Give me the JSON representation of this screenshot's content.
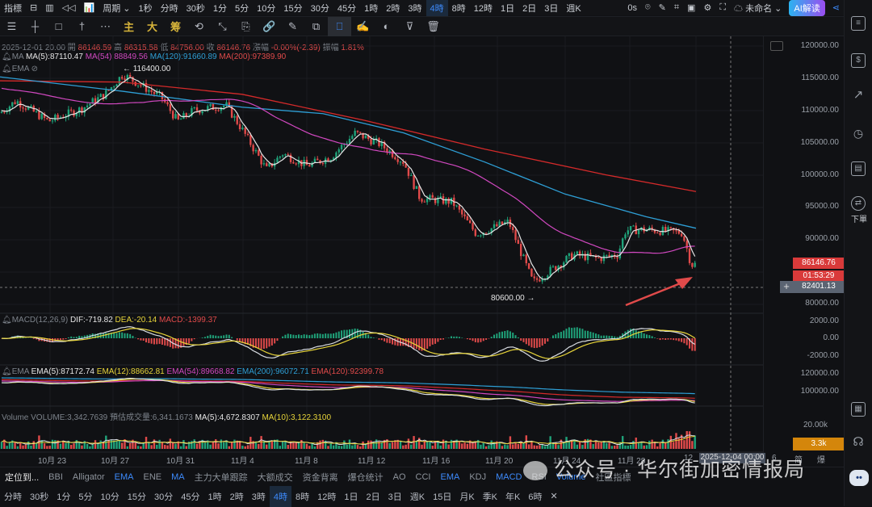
{
  "topbar": {
    "items": [
      "指標",
      "⊟",
      "▥",
      "◁◁",
      "📊",
      "周期 ⌄",
      "1秒",
      "分時",
      "30秒",
      "1分",
      "5分",
      "10分",
      "15分",
      "30分",
      "45分",
      "1時",
      "2時",
      "3時",
      "4時",
      "8時",
      "12時",
      "1日",
      "2日",
      "3日",
      "週K"
    ],
    "active": "4時",
    "timer": "0s",
    "workspace": "未命名",
    "ai_label": "AI解读"
  },
  "toolbar2": {
    "tools": [
      "☰",
      "┼",
      "□",
      "†",
      "⋯"
    ],
    "yellow": [
      "主",
      "大",
      "筹"
    ],
    "more": [
      "⟲",
      "⤡",
      "⎘",
      "🔗",
      "✎",
      "⧉",
      "⎕",
      "✍",
      "◐",
      "⊽",
      "🗑"
    ]
  },
  "info": {
    "date": "2025-12-01 20:00",
    "open_label": "開",
    "open": "86146.59",
    "high_label": "高",
    "high": "86315.58",
    "low_label": "低",
    "low": "84756.00",
    "close_label": "收",
    "close": "86146.76",
    "chg_label": "漲幅",
    "chg": "-0.00%(-2.39)",
    "amp_label": "振幅",
    "amp": "1.81%"
  },
  "ma": {
    "label": "MA",
    "ma5": "MA(5):87110.47",
    "ma54": "MA(54):88849.56",
    "ma120": "MA(120):91660.89",
    "ma200": "MA(200):97389.90"
  },
  "ema_toggle": "EMA",
  "annotations": {
    "high": "← 116400.00",
    "low": "80600.00 →"
  },
  "price_axis": [
    "120000.00",
    "115000.00",
    "110000.00",
    "105000.00",
    "100000.00",
    "95000.00",
    "90000.00",
    "80000.00"
  ],
  "last_price": "86146.76",
  "countdown": "01:53:29",
  "crosshair_price": "82401.13",
  "macd": {
    "label": "MACD(12,26,9)",
    "dif": "DIF:-719.82",
    "dea": "DEA:-20.14",
    "macd": "MACD:-1399.37",
    "axis": [
      "2000.00",
      "0.00",
      "-2000.00"
    ]
  },
  "ema": {
    "label": "EMA",
    "e5": "EMA(5):87172.74",
    "e12": "EMA(12):88662.81",
    "e54": "EMA(54):89668.82",
    "e200": "EMA(200):96072.71",
    "e120": "EMA(120):92399.78",
    "axis": [
      "120000.00",
      "100000.00"
    ]
  },
  "volume": {
    "label": "Volume",
    "vol": "VOLUME:3,342.7639",
    "est": "預估成交量:6,341.1673",
    "ma5": "MA(5):4,672.8307",
    "ma10": "MA(10):3,122.3100",
    "axis": "20.00k",
    "badge": "3.3k"
  },
  "dates": [
    "10月 23",
    "10月 27",
    "10月 31",
    "11月 4",
    "11月 8",
    "11月 12",
    "11月 16",
    "11月 20",
    "11月 24",
    "11月 28",
    "12"
  ],
  "crosshair_date": "2025-12-04 00:00",
  "date_tail": "6",
  "corner_labels": [
    "简",
    "爆"
  ],
  "indicators": {
    "locate": "定位到...",
    "items": [
      "BBI",
      "Alligator",
      "EMA",
      "ENE",
      "MA",
      "主力大单跟踪",
      "大额成交",
      "资金背离",
      "爆仓统计",
      "AO",
      "CCI",
      "EMA",
      "KDJ",
      "MACD",
      "RSI",
      "Volume",
      "社區指標"
    ],
    "active": [
      "EMA",
      "MA",
      "MACD",
      "Volume"
    ]
  },
  "timeframes": {
    "items": [
      "分時",
      "30秒",
      "1分",
      "5分",
      "10分",
      "15分",
      "30分",
      "45分",
      "1時",
      "2時",
      "3時",
      "4時",
      "8時",
      "12時",
      "1日",
      "2日",
      "3日",
      "週K",
      "15日",
      "月K",
      "季K",
      "年K",
      "6時",
      "✕"
    ],
    "active": "4時"
  },
  "sidebar": {
    "order": "下單"
  },
  "watermark": "公众号 · 华尔街加密情报局",
  "colors": {
    "up": "#1fa37a",
    "down": "#e04a4a",
    "accent": "#3d8bfd",
    "ma5": "#e6e6e6",
    "ma54": "#d148c0",
    "ma120": "#2e9fd6",
    "ma200": "#d42a2a",
    "yellow": "#e8d53a",
    "volume_badge": "#d4860b"
  }
}
